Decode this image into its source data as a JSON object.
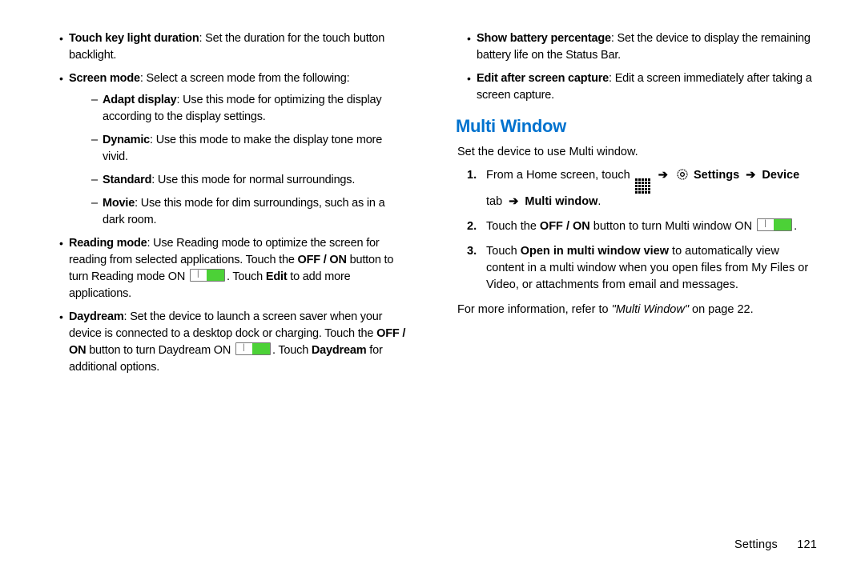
{
  "left": {
    "items": [
      {
        "term": "Touch key light duration",
        "body": ": Set the duration for the touch button backlight."
      },
      {
        "term": "Screen mode",
        "body": ": Select a screen mode from the following:",
        "sub": [
          {
            "term": "Adapt display",
            "body": ": Use this mode for optimizing the display according to the display settings."
          },
          {
            "term": "Dynamic",
            "body": ": Use this mode to make the display tone more vivid."
          },
          {
            "term": "Standard",
            "body": ": Use this mode for normal surroundings."
          },
          {
            "term": "Movie",
            "body": ": Use this mode for dim surroundings, such as in a dark room."
          }
        ]
      },
      {
        "term": "Reading mode",
        "body1": ": Use Reading mode to optimize the screen for reading from selected applications. Touch the ",
        "offon": "OFF / ON",
        "body2": " button to turn Reading mode ON ",
        "body3": ". Touch ",
        "edit": "Edit",
        "body4": " to add more applications."
      },
      {
        "term": "Daydream",
        "body1": ": Set the device to launch a screen saver when your device is connected to a desktop dock or charging. Touch the ",
        "offon": "OFF / ON",
        "body2": " button to turn Daydream ON ",
        "body3": ". Touch ",
        "daydream": "Daydream",
        "body4": " for additional options."
      }
    ]
  },
  "right": {
    "top_items": [
      {
        "term": "Show battery percentage",
        "body": ": Set the device to display the remaining battery life on the Status Bar."
      },
      {
        "term": "Edit after screen capture",
        "body": ": Edit a screen immediately after taking a screen capture."
      }
    ],
    "heading": "Multi Window",
    "intro": "Set the device to use Multi window.",
    "steps": {
      "s1_a": "From a Home screen, touch ",
      "s1_settings": "Settings",
      "s1_device": "Device",
      "s1_tab": " tab ",
      "s1_mw": "Multi window",
      "s2_a": "Touch the ",
      "s2_offon": "OFF / ON",
      "s2_b": " button to turn Multi window ON ",
      "s2_c": ".",
      "s3_a": "Touch ",
      "s3_bold": "Open in multi window view",
      "s3_b": " to automatically view content in a multi window when you open files from My Files or Video, or attachments from email and messages."
    },
    "xref_a": "For more information, refer to ",
    "xref_i": "\"Multi Window\"",
    "xref_b": " on page 22."
  },
  "footer": {
    "label": "Settings",
    "page": "121"
  }
}
